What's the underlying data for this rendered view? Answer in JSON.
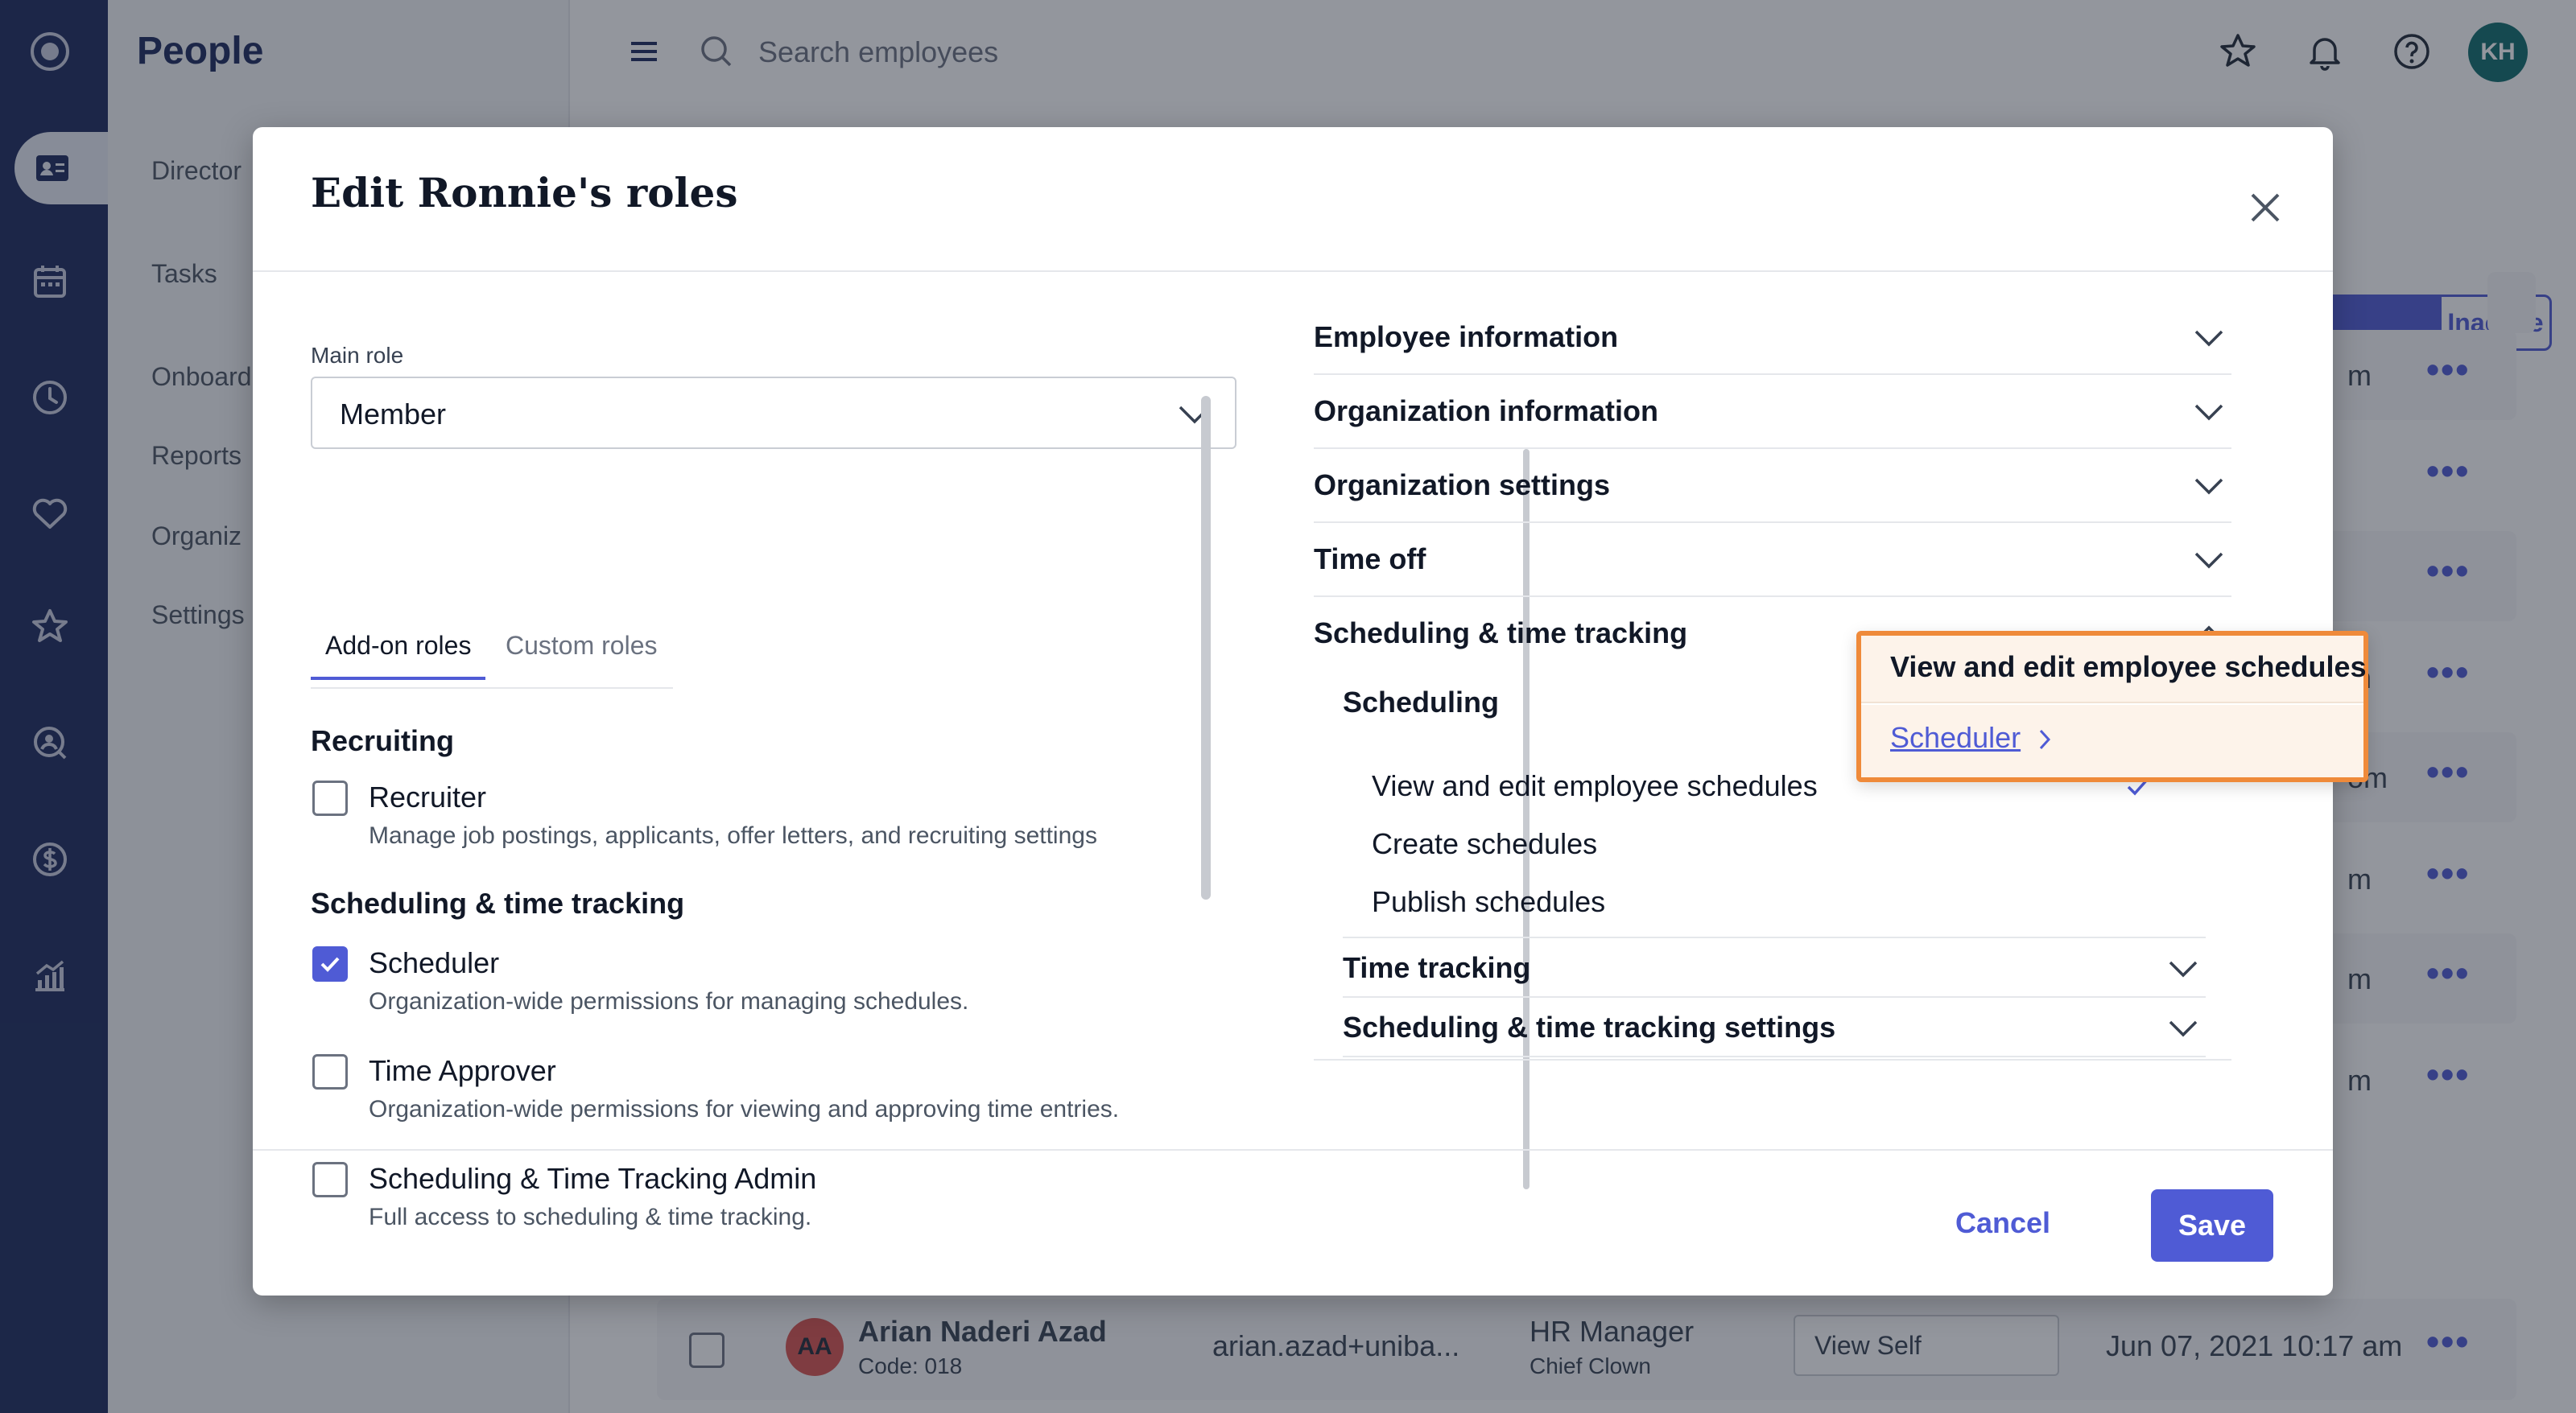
{
  "app": {
    "title": "People",
    "nav_icons": [
      "logo-icon",
      "people-icon",
      "calendar-icon",
      "clock-icon",
      "heart-icon",
      "star-icon",
      "search-person-icon",
      "dollar-icon",
      "analytics-icon"
    ]
  },
  "subnav": {
    "items": [
      "Director",
      "Tasks",
      "Onboard",
      "Reports",
      "Organiz",
      "Settings"
    ]
  },
  "topbar": {
    "search_placeholder": "Search employees",
    "avatar_initials": "KH"
  },
  "background": {
    "status_toggle_inactive": "Inactive",
    "row_suffixes": [
      "m",
      "m",
      "m",
      "om",
      "m",
      "m",
      "m"
    ],
    "employee": {
      "initials": "AA",
      "name": "Arian Naderi Azad",
      "code": "Code: 018",
      "email": "arian.azad+uniba...",
      "title": "HR Manager",
      "subtitle": "Chief Clown",
      "role_select": "View Self",
      "date": "Jun 07, 2021 10:17 am"
    }
  },
  "modal": {
    "title": "Edit Ronnie's roles",
    "main_role_label": "Main role",
    "main_role_value": "Member",
    "tabs": [
      "Add-on roles",
      "Custom roles"
    ],
    "sections": {
      "recruiting": "Recruiting",
      "scheduling": "Scheduling & time tracking"
    },
    "roles": [
      {
        "title": "Recruiter",
        "desc": "Manage job postings, applicants, offer letters, and recruiting settings",
        "checked": false
      },
      {
        "title": "Scheduler",
        "desc": "Organization-wide permissions for managing schedules.",
        "checked": true
      },
      {
        "title": "Time Approver",
        "desc": "Organization-wide permissions for viewing and approving time entries.",
        "checked": false
      },
      {
        "title": "Scheduling & Time Tracking Admin",
        "desc": "Full access to scheduling & time tracking.",
        "checked": false
      }
    ],
    "permission_groups": [
      "Employee information",
      "Organization information",
      "Organization settings",
      "Time off",
      "Scheduling & time tracking"
    ],
    "scheduling_subgroup": "Scheduling",
    "permissions": [
      "View and edit employee schedules",
      "Create schedules",
      "Publish schedules"
    ],
    "other_subgroups": [
      "Time tracking",
      "Scheduling & time tracking settings"
    ],
    "popover": {
      "title": "View and edit employee schedules",
      "link": "Scheduler"
    },
    "cancel_label": "Cancel",
    "save_label": "Save"
  },
  "colors": {
    "accent": "#4f5bd5",
    "nav_bg": "#1b2a5c",
    "highlight_border": "#ef8a3a"
  }
}
